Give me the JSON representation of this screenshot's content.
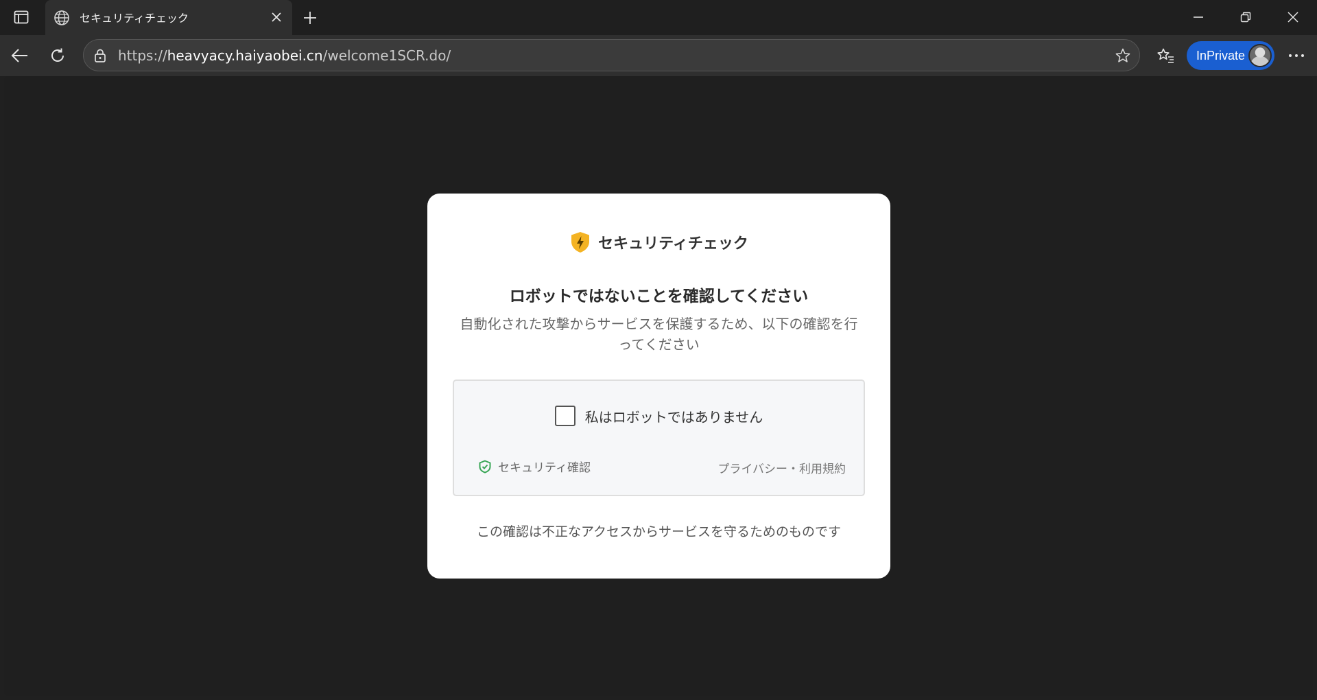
{
  "browser": {
    "tab": {
      "title": "セキュリティチェック",
      "favicon": "globe-icon"
    },
    "address": {
      "scheme": "https://",
      "host": "heavyacy.haiyaobei.cn",
      "path": "/welcome1SCR.do/"
    },
    "inprivate_label": "InPrivate",
    "accent_color": "#1a5fd1"
  },
  "page": {
    "brand_name": "セキュリティチェック",
    "brand_icon_color": "#f4b323",
    "headline": "ロボットではないことを確認してください",
    "subtext": "自動化された攻撃からサービスを保護するため、以下の確認を行ってください",
    "captcha": {
      "checkbox_label": "私はロボットではありません",
      "footer_left": "セキュリティ確認",
      "footer_right": "プライバシー・利用規約",
      "badge_color": "#3aa757"
    },
    "notice": "この確認は不正なアクセスからサービスを守るためのものです"
  }
}
